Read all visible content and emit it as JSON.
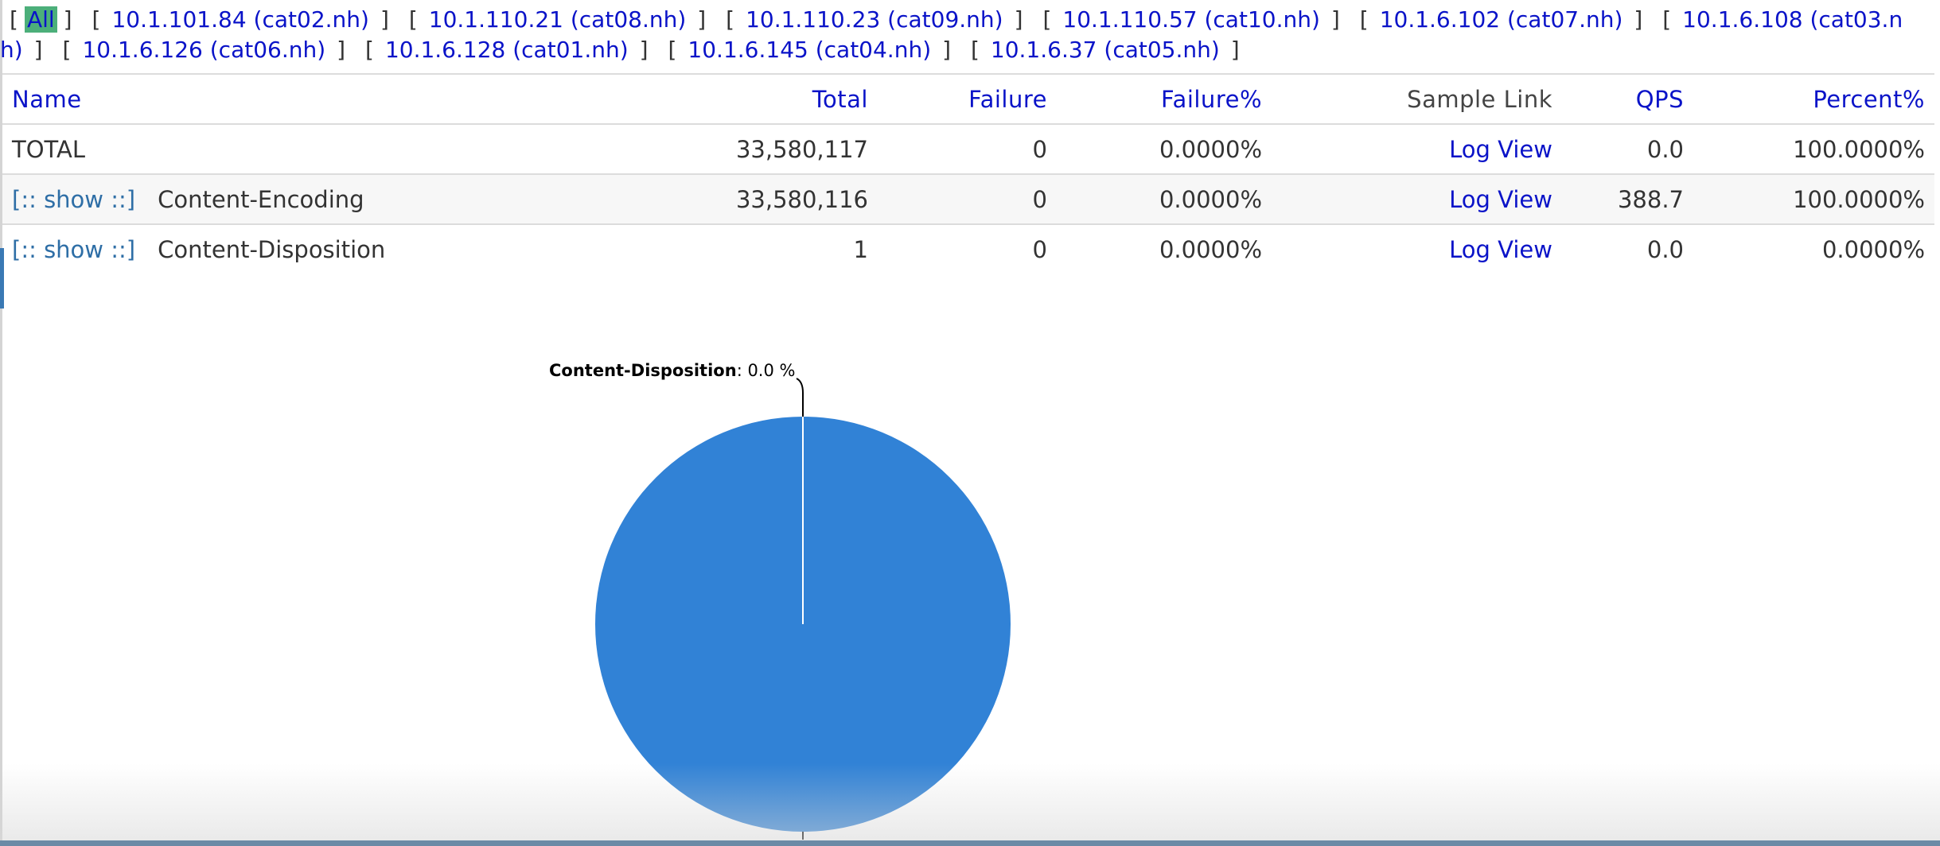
{
  "servers": {
    "all_label": "All",
    "items": [
      "10.1.101.84 (cat02.nh)",
      "10.1.110.21 (cat08.nh)",
      "10.1.110.23 (cat09.nh)",
      "10.1.110.57 (cat10.nh)",
      "10.1.6.102 (cat07.nh)",
      "10.1.6.108 (cat03.nh)",
      "10.1.6.126 (cat06.nh)",
      "10.1.6.128 (cat01.nh)",
      "10.1.6.145 (cat04.nh)",
      "10.1.6.37 (cat05.nh)"
    ]
  },
  "table": {
    "headers": {
      "name": "Name",
      "total": "Total",
      "failure": "Failure",
      "failure_pct": "Failure%",
      "sample": "Sample Link",
      "qps": "QPS",
      "percent": "Percent%"
    },
    "show_label": "[:: show ::]",
    "log_label": "Log View",
    "rows": [
      {
        "name": "TOTAL",
        "total": "33,580,117",
        "failure": "0",
        "failure_pct": "0.0000%",
        "qps": "0.0",
        "percent": "100.0000%"
      },
      {
        "name": "Content-Encoding",
        "total": "33,580,116",
        "failure": "0",
        "failure_pct": "0.0000%",
        "qps": "388.7",
        "percent": "100.0000%"
      },
      {
        "name": "Content-Disposition",
        "total": "1",
        "failure": "0",
        "failure_pct": "0.0000%",
        "qps": "0.0",
        "percent": "0.0000%"
      }
    ]
  },
  "chart_data": {
    "type": "pie",
    "slices": [
      {
        "label": "Content-Encoding",
        "value": 33580116,
        "color": "#3182d6"
      },
      {
        "label": "Content-Disposition",
        "value": 1,
        "color": "#3182d6"
      }
    ],
    "annotations": [
      {
        "name": "Content-Disposition",
        "text": ": 0.0 %"
      }
    ]
  }
}
